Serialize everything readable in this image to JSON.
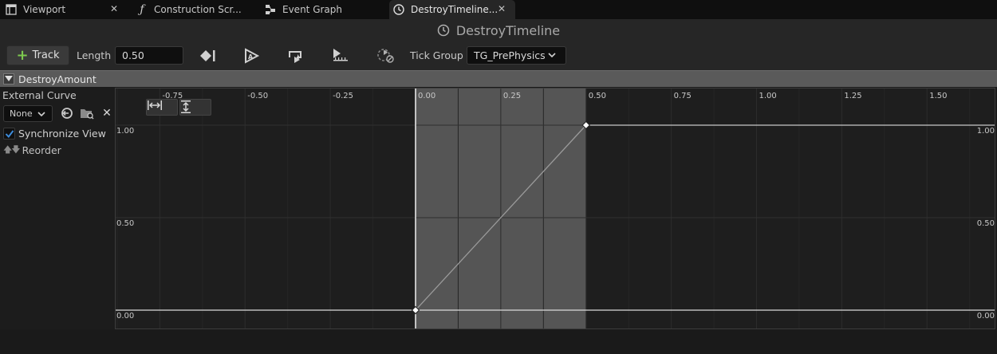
{
  "tabs": [
    {
      "label": "Viewport",
      "icon": "viewport-icon",
      "active": false,
      "closable": true
    },
    {
      "label": "Construction Scr...",
      "icon": "function-icon",
      "active": false,
      "closable": false
    },
    {
      "label": "Event Graph",
      "icon": "graph-icon",
      "active": false,
      "closable": false
    },
    {
      "label": "DestroyTimeline...",
      "icon": "clock-icon",
      "active": true,
      "closable": true
    }
  ],
  "title": "DestroyTimeline",
  "toolbar": {
    "track_label": "Track",
    "length_label": "Length",
    "length_value": "0.50",
    "tick_group_label": "Tick Group",
    "tick_group_value": "TG_PrePhysics",
    "icons": [
      "add-key-icon",
      "autoplay-icon",
      "loop-icon",
      "use-last-keyframe-icon",
      "ignore-time-dilation-icon"
    ]
  },
  "track": {
    "name": "DestroyAmount",
    "external_curve_label": "External Curve",
    "curve_select_value": "None",
    "synchronize_view_label": "Synchronize View",
    "synchronize_view_checked": true,
    "reorder_label": "Reorder"
  },
  "graph": {
    "x_ticks": [
      "-0.75",
      "-0.50",
      "-0.25",
      "0.00",
      "0.25",
      "0.50",
      "0.75",
      "1.00",
      "1.25",
      "1.50"
    ],
    "y_ticks": [
      "1.00",
      "0.50",
      "0.00"
    ],
    "timeline_range": [
      0.0,
      0.5
    ],
    "keys": [
      {
        "time": 0.0,
        "value": 0.0
      },
      {
        "time": 0.5,
        "value": 1.0
      }
    ]
  },
  "colors": {
    "accent_green": "#7ec94f",
    "checkbox_blue": "#3d8bd9",
    "active_range": "#555555"
  }
}
